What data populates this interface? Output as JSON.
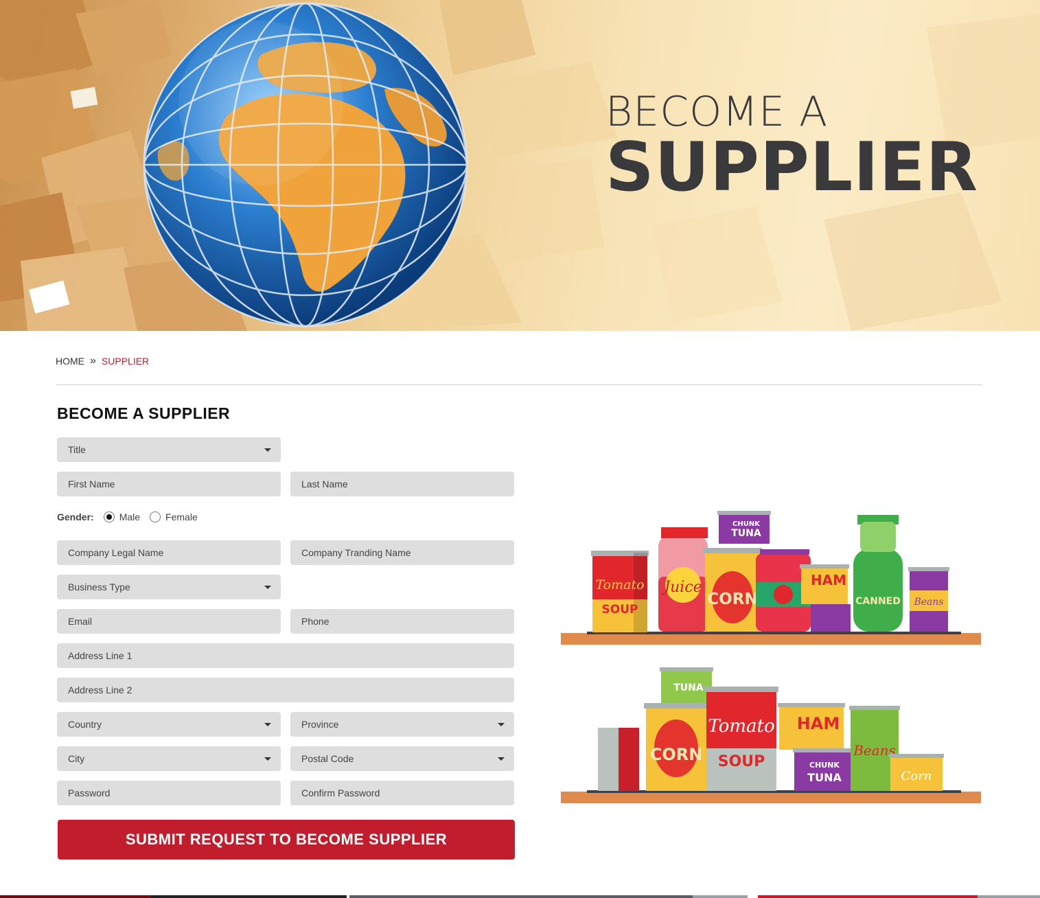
{
  "hero": {
    "line1": "BECOME A",
    "line2": "SUPPLIER"
  },
  "breadcrumb": {
    "home": "HOME",
    "separator": "»",
    "current": "SUPPLIER"
  },
  "form": {
    "title": "BECOME A SUPPLIER",
    "title_select": "Title",
    "first_name": "First Name",
    "last_name": "Last Name",
    "gender_label": "Gender:",
    "gender_male": "Male",
    "gender_female": "Female",
    "gender_selected": "Male",
    "company_legal_name": "Company Legal Name",
    "company_trading_name": "Company Tranding Name",
    "business_type": "Business Type",
    "email": "Email",
    "phone": "Phone",
    "address1": "Address Line 1",
    "address2": "Address Line 2",
    "country": "Country",
    "province": "Province",
    "city": "City",
    "postal_code": "Postal Code",
    "password": "Password",
    "confirm_password": "Confirm Password",
    "submit_label": "SUBMIT REQUEST TO BECOME SUPPLIER"
  },
  "illustration": {
    "labels": [
      "Tomato",
      "SOUP",
      "Juice",
      "CORN",
      "HAM",
      "CHUNK",
      "TUNA",
      "CANNED",
      "Beans",
      "Corn"
    ]
  },
  "colors": {
    "accent": "#c21d2d",
    "field_bg": "#dedede",
    "hero_text": "#3a3a3c"
  }
}
